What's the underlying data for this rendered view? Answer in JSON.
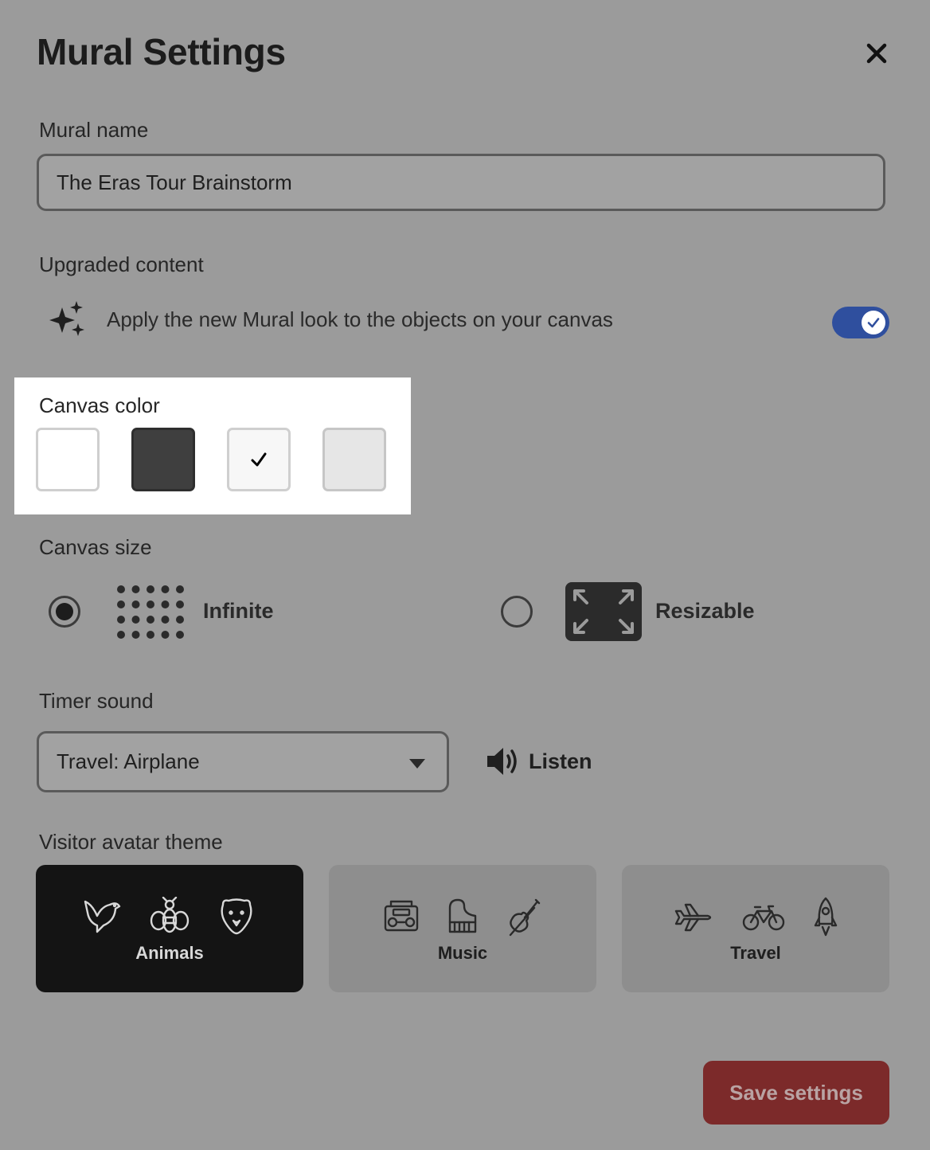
{
  "dialog": {
    "title": "Mural Settings",
    "close_icon": "close-icon"
  },
  "mural_name": {
    "label": "Mural name",
    "value": "The Eras Tour Brainstorm"
  },
  "upgraded_content": {
    "label": "Upgraded content",
    "description": "Apply the new Mural look to the objects on your canvas",
    "icon": "sparkles-icon",
    "enabled": true
  },
  "canvas_color": {
    "label": "Canvas color",
    "options": [
      {
        "color": "#ffffff",
        "selected": false
      },
      {
        "color": "#3f3f3f",
        "selected": false
      },
      {
        "color": "#f7f7f7",
        "selected": true
      },
      {
        "color": "#e6e6e6",
        "selected": false
      }
    ],
    "highlight_color": "#ffffff"
  },
  "canvas_size": {
    "label": "Canvas size",
    "options": [
      {
        "label": "Infinite",
        "icon": "dot-grid-icon",
        "selected": true
      },
      {
        "label": "Resizable",
        "icon": "expand-arrows-icon",
        "selected": false
      }
    ]
  },
  "timer_sound": {
    "label": "Timer sound",
    "selected": "Travel: Airplane",
    "listen_label": "Listen",
    "listen_icon": "speaker-icon"
  },
  "avatar_theme": {
    "label": "Visitor avatar theme",
    "themes": [
      {
        "label": "Animals",
        "icons": [
          "bird-icon",
          "bee-icon",
          "bear-icon"
        ],
        "selected": true
      },
      {
        "label": "Music",
        "icons": [
          "boombox-icon",
          "piano-icon",
          "violin-icon"
        ],
        "selected": false
      },
      {
        "label": "Travel",
        "icons": [
          "airplane-icon",
          "bicycle-icon",
          "rocket-icon"
        ],
        "selected": false
      }
    ]
  },
  "save_label": "Save settings",
  "colors": {
    "overlay_bg": "#9b9b9b",
    "toggle_on": "#2f4f9e",
    "save_button": "#7c2a2a",
    "selected_theme": "#141414"
  }
}
